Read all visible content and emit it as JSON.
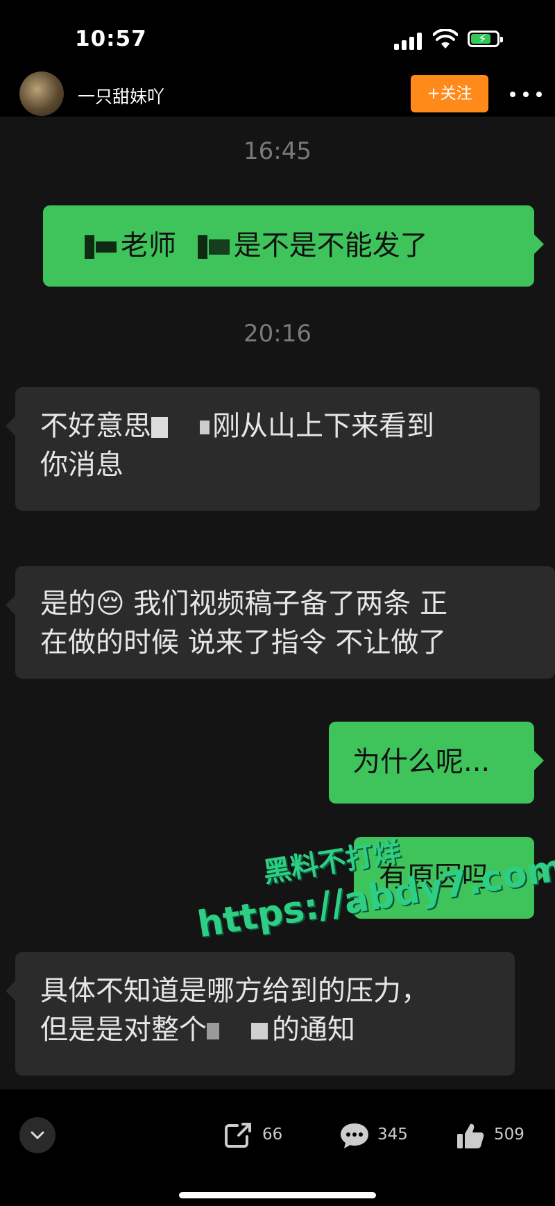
{
  "status_bar": {
    "time": "10:57"
  },
  "header": {
    "username": "一只甜妹吖",
    "follow_label": "+关注"
  },
  "messages": [
    {
      "type": "timestamp",
      "text": "16:45"
    },
    {
      "type": "me",
      "parts": [
        "老师",
        "是不是不能发了"
      ]
    },
    {
      "type": "timestamp",
      "text": "20:16"
    },
    {
      "type": "them",
      "line1a": "不好意思",
      "line1b": "刚从山上下来看到",
      "line2": "你消息"
    },
    {
      "type": "them",
      "line1a": "是的",
      "emoji": "😔",
      "line1b": " 我们视频稿子备了两条 正",
      "line2": "在做的时候 说来了指令 不让做了"
    },
    {
      "type": "me",
      "text": "为什么呢..."
    },
    {
      "type": "me",
      "text": "有原因吗"
    },
    {
      "type": "them",
      "line1": "具体不知道是哪方给到的压力，",
      "line2a": "但是是对整个",
      "line2b": "的通知"
    }
  ],
  "watermark": {
    "line1": "黑料不打烊",
    "line2": "https://abdy7.com"
  },
  "actions": {
    "share_count": "66",
    "comment_count": "345",
    "like_count": "509"
  },
  "icons": [
    "signal-icon",
    "wifi-icon",
    "battery-icon",
    "more-icon",
    "chevron-down-icon",
    "share-icon",
    "comment-icon",
    "like-icon"
  ],
  "colors": {
    "accent_follow": "#ff8a1a",
    "bubble_me": "#3fc45c",
    "bubble_them": "#2b2b2b",
    "watermark": "#2ecf85"
  }
}
